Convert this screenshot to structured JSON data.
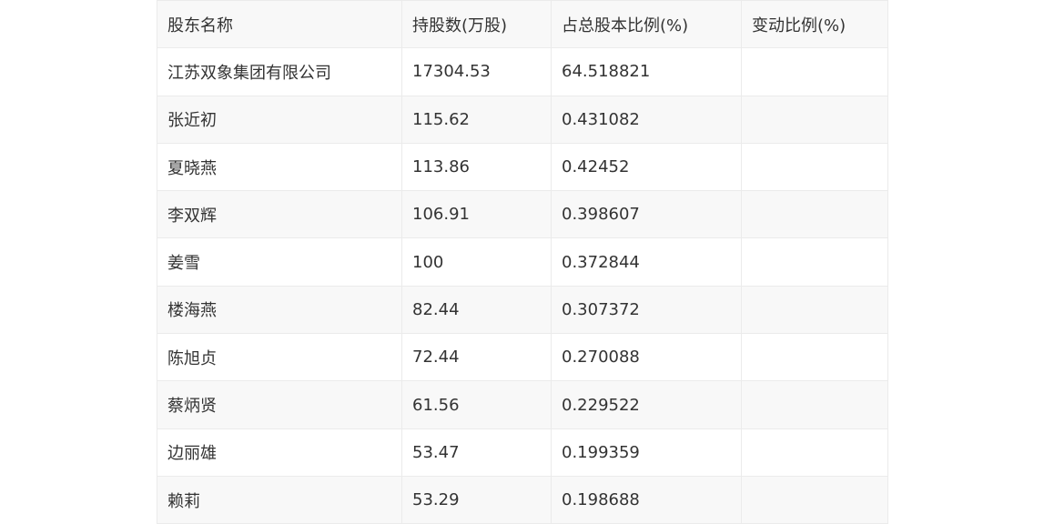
{
  "table": {
    "headers": [
      "股东名称",
      "持股数(万股)",
      "占总股本比例(%)",
      "变动比例(%)"
    ],
    "rows": [
      {
        "name": "江苏双象集团有限公司",
        "shares": "17304.53",
        "ratio": "64.518821",
        "change": ""
      },
      {
        "name": "张近初",
        "shares": "115.62",
        "ratio": "0.431082",
        "change": ""
      },
      {
        "name": "夏晓燕",
        "shares": "113.86",
        "ratio": "0.42452",
        "change": ""
      },
      {
        "name": "李双辉",
        "shares": "106.91",
        "ratio": "0.398607",
        "change": ""
      },
      {
        "name": "姜雪",
        "shares": "100",
        "ratio": "0.372844",
        "change": ""
      },
      {
        "name": "楼海燕",
        "shares": "82.44",
        "ratio": "0.307372",
        "change": ""
      },
      {
        "name": "陈旭贞",
        "shares": "72.44",
        "ratio": "0.270088",
        "change": ""
      },
      {
        "name": "蔡炳贤",
        "shares": "61.56",
        "ratio": "0.229522",
        "change": ""
      },
      {
        "name": "边丽雄",
        "shares": "53.47",
        "ratio": "0.199359",
        "change": ""
      },
      {
        "name": "赖莉",
        "shares": "53.29",
        "ratio": "0.198688",
        "change": ""
      }
    ]
  }
}
